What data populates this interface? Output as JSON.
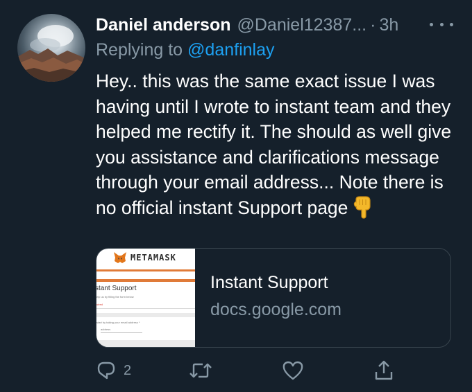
{
  "tweet": {
    "author_name": "Daniel anderson",
    "author_handle": "@Daniel12387...",
    "separator": "·",
    "time": "3h",
    "replying_prefix": "Replying to",
    "replying_to": "@danfinlay",
    "text": "Hey.. this was the same exact issue I was having until I wrote to instant team and they helped me rectify it. The should as well give you assistance and clarifications message through your email address... Note there is no official instant Support page",
    "emoji": "pointing-down-hand"
  },
  "card": {
    "title": "Instant Support",
    "domain": "docs.google.com",
    "thumbnail": {
      "brand": "METAMASK",
      "heading": "stant Support",
      "line1": "elp us by filling the form below",
      "line2": "uired",
      "line3": "start by taking your email address *",
      "line4": "address"
    }
  },
  "actions": {
    "reply_count": "2",
    "icons": [
      "reply-icon",
      "retweet-icon",
      "like-icon",
      "share-icon"
    ]
  },
  "colors": {
    "background": "#15202b",
    "secondary_text": "#8899a6",
    "link": "#1da1f2",
    "border": "#38444d",
    "metamask_orange": "#e07b39"
  }
}
